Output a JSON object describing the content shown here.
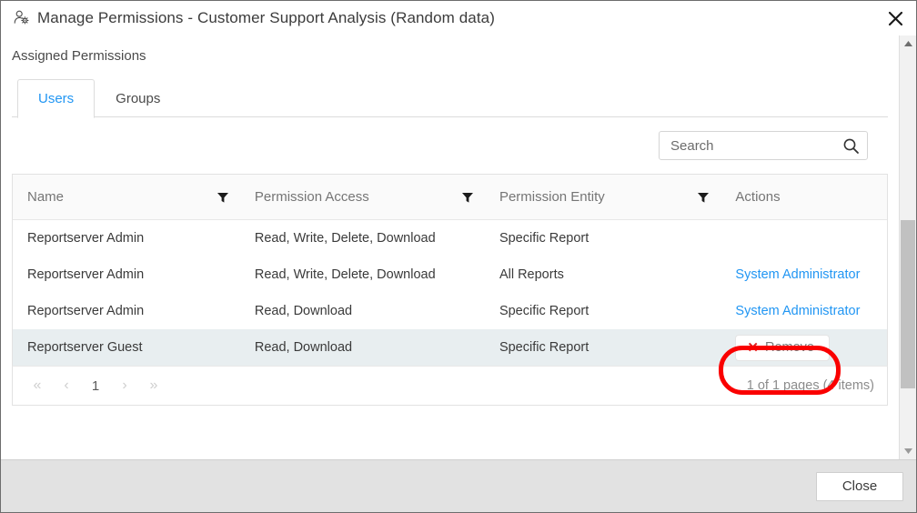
{
  "window": {
    "title": "Manage Permissions - Customer Support Analysis (Random data)",
    "title_icon": "user-settings-icon",
    "close_icon": "✕"
  },
  "section": {
    "label": "Assigned Permissions"
  },
  "tabs": [
    {
      "label": "Users",
      "active": true
    },
    {
      "label": "Groups",
      "active": false
    }
  ],
  "search": {
    "value": "",
    "placeholder": "Search",
    "icon": "search-icon"
  },
  "grid": {
    "columns": [
      {
        "label": "Name",
        "filter_icon": "filter-icon"
      },
      {
        "label": "Permission Access",
        "filter_icon": "filter-icon"
      },
      {
        "label": "Permission Entity",
        "filter_icon": "filter-icon"
      },
      {
        "label": "Actions",
        "filter_icon": null
      }
    ],
    "rows": [
      {
        "name": "Reportserver Admin",
        "access": "Read, Write, Delete, Download",
        "entity": "Specific Report",
        "action_label": "",
        "action_type": "none",
        "highlighted": false
      },
      {
        "name": "Reportserver Admin",
        "access": "Read, Write, Delete, Download",
        "entity": "All Reports",
        "action_label": "System Administrator",
        "action_type": "link",
        "highlighted": false
      },
      {
        "name": "Reportserver Admin",
        "access": "Read, Download",
        "entity": "Specific Report",
        "action_label": "System Administrator",
        "action_type": "link",
        "highlighted": false
      },
      {
        "name": "Reportserver Guest",
        "access": "Read, Download",
        "entity": "Specific Report",
        "action_label": "Remove",
        "action_type": "remove-button",
        "highlighted": true
      }
    ]
  },
  "pager": {
    "first_label": "«",
    "prev_label": "‹",
    "current_page": "1",
    "next_label": "›",
    "last_label": "»",
    "info": "1 of 1 pages (4 items)"
  },
  "footer": {
    "close_label": "Close"
  },
  "scrollbar": {
    "up_icon": "caret-up-icon",
    "down_icon": "caret-down-icon"
  },
  "colors": {
    "accent_link": "#2196f3",
    "annotation_red": "#fa0000",
    "remove_x_red": "#e02020",
    "row_highlight": "#e8eef0",
    "footer_bg": "#e2e2e2"
  }
}
